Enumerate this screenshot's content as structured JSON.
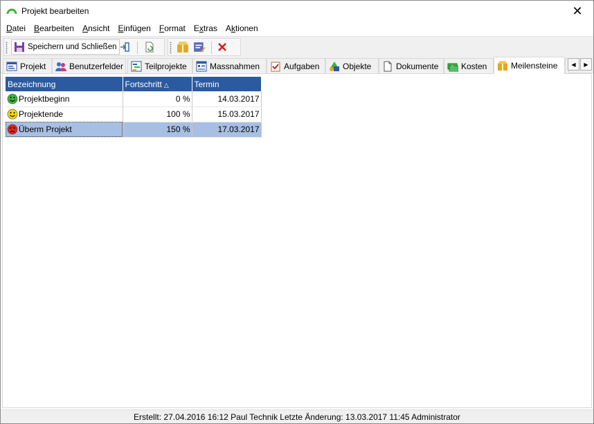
{
  "window": {
    "title": "Projekt bearbeiten",
    "close_glyph": "✕"
  },
  "menu": [
    {
      "pre": "",
      "u": "D",
      "post": "atei"
    },
    {
      "pre": "",
      "u": "B",
      "post": "earbeiten"
    },
    {
      "pre": "",
      "u": "A",
      "post": "nsicht"
    },
    {
      "pre": "",
      "u": "E",
      "post": "infügen"
    },
    {
      "pre": "",
      "u": "F",
      "post": "ormat"
    },
    {
      "pre": "E",
      "u": "x",
      "post": "tras"
    },
    {
      "pre": "A",
      "u": "k",
      "post": "tionen"
    }
  ],
  "toolbar": {
    "save_close_label": "Speichern und Schließen"
  },
  "tabs": [
    {
      "label": "Projekt",
      "icon": "project-icon"
    },
    {
      "label": "Benutzerfelder",
      "icon": "users-icon"
    },
    {
      "label": "Teilprojekte",
      "icon": "subprojects-icon"
    },
    {
      "label": "Massnahmen",
      "icon": "measures-icon"
    },
    {
      "label": "Aufgaben",
      "icon": "tasks-icon"
    },
    {
      "label": "Objekte",
      "icon": "objects-icon"
    },
    {
      "label": "Dokumente",
      "icon": "documents-icon"
    },
    {
      "label": "Kosten",
      "icon": "costs-icon"
    },
    {
      "label": "Meilensteine",
      "icon": "milestones-icon"
    }
  ],
  "grid": {
    "columns": [
      "Bezeichnung",
      "Fortschritt",
      "Termin"
    ],
    "sort_glyph": "△",
    "rows": [
      {
        "name": "Projektbeginn",
        "progress": "0 %",
        "date": "14.03.2017",
        "status": "green",
        "smiley": "happy"
      },
      {
        "name": "Projektende",
        "progress": "100 %",
        "date": "15.03.2017",
        "status": "yellow",
        "smiley": "happy"
      },
      {
        "name": "Überm Projekt",
        "progress": "150 %",
        "date": "17.03.2017",
        "status": "red",
        "smiley": "sad"
      }
    ]
  },
  "colors": {
    "header_bg": "#2c5aa0",
    "selected_row": "#a7bfe2",
    "green": "#3cb43c",
    "yellow": "#f5d800",
    "red": "#e02020"
  },
  "statusbar": {
    "text": "Erstellt: 27.04.2016 16:12 Paul Technik  Letzte Änderung: 13.03.2017 11:45 Administrator"
  }
}
